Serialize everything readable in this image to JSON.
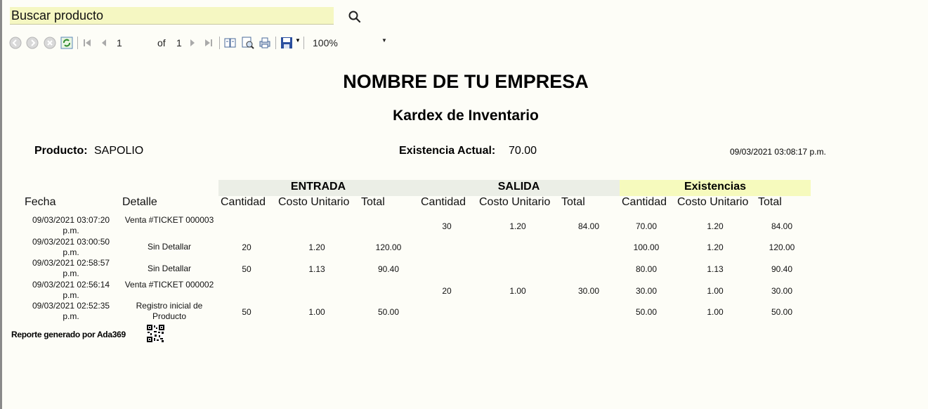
{
  "search": {
    "value": "Buscar producto"
  },
  "toolbar": {
    "page_current": "1",
    "page_of": "of",
    "page_total": "1",
    "zoom": "100%"
  },
  "report": {
    "company": "NOMBRE DE TU EMPRESA",
    "title": "Kardex de Inventario",
    "product_label": "Producto:",
    "product_value": "SAPOLIO",
    "stock_label": "Existencia Actual:",
    "stock_value": "70.00",
    "generated_at": "09/03/2021 03:08:17 p.m.",
    "groups": {
      "entrada": "ENTRADA",
      "salida": "SALIDA",
      "existencias": "Existencias"
    },
    "headers": {
      "fecha": "Fecha",
      "detalle": "Detalle",
      "cantidad": "Cantidad",
      "costo": "Costo Unitario",
      "total": "Total"
    },
    "rows": [
      {
        "fecha": "09/03/2021 03:07:20 p.m.",
        "detalle": "Venta #TICKET 000003",
        "e_cant": "",
        "e_costo": "",
        "e_total": "",
        "s_cant": "30",
        "s_costo": "1.20",
        "s_total": "84.00",
        "x_cant": "70.00",
        "x_costo": "1.20",
        "x_total": "84.00"
      },
      {
        "fecha": "09/03/2021 03:00:50 p.m.",
        "detalle": "Sin Detallar",
        "e_cant": "20",
        "e_costo": "1.20",
        "e_total": "120.00",
        "s_cant": "",
        "s_costo": "",
        "s_total": "",
        "x_cant": "100.00",
        "x_costo": "1.20",
        "x_total": "120.00"
      },
      {
        "fecha": "09/03/2021 02:58:57 p.m.",
        "detalle": "Sin Detallar",
        "e_cant": "50",
        "e_costo": "1.13",
        "e_total": "90.40",
        "s_cant": "",
        "s_costo": "",
        "s_total": "",
        "x_cant": "80.00",
        "x_costo": "1.13",
        "x_total": "90.40"
      },
      {
        "fecha": "09/03/2021 02:56:14 p.m.",
        "detalle": "Venta #TICKET 000002",
        "e_cant": "",
        "e_costo": "",
        "e_total": "",
        "s_cant": "20",
        "s_costo": "1.00",
        "s_total": "30.00",
        "x_cant": "30.00",
        "x_costo": "1.00",
        "x_total": "30.00"
      },
      {
        "fecha": "09/03/2021 02:52:35 p.m.",
        "detalle": "Registro inicial de Producto",
        "e_cant": "50",
        "e_costo": "1.00",
        "e_total": "50.00",
        "s_cant": "",
        "s_costo": "",
        "s_total": "",
        "x_cant": "50.00",
        "x_costo": "1.00",
        "x_total": "50.00"
      }
    ],
    "footer": "Reporte generado por Ada369"
  },
  "colors": {
    "entrada_band": "#ebeee6",
    "salida_band": "#ebeee6",
    "existencias_band": "#f6fabd"
  }
}
